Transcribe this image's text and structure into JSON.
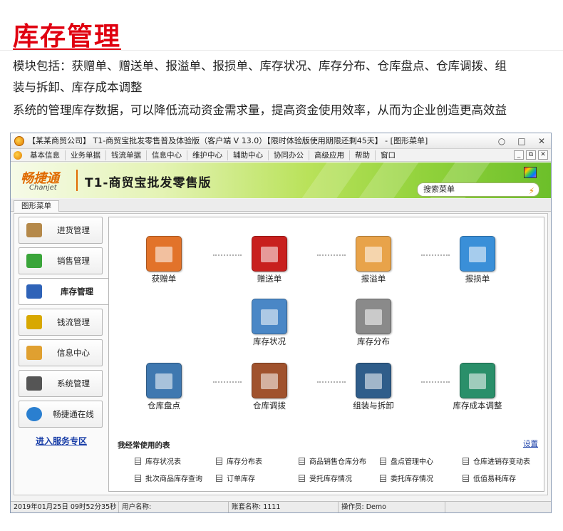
{
  "header": {
    "title": "库存管理",
    "line1": "模块包括：获赠单、赠送单、报溢单、报损单、库存状况、库存分布、仓库盘点、仓库调拨、组",
    "line2": "装与拆卸、库存成本调整",
    "line3": "系统的管理库存数据，可以降低流动资金需求量，提高资金使用效率，从而为企业创造更高效益",
    "accent_color": "#e00010"
  },
  "window": {
    "title": "【某某商贸公司】 T1-商贸宝批发零售普及体验版（客户端 V 13.0）【限时体验版使用期限还剩45天】 - [图形菜单]",
    "controls": [
      "○",
      "□",
      "✕"
    ]
  },
  "menu": {
    "items": [
      "基本信息",
      "业务单据",
      "钱流单据",
      "信息中心",
      "维护中心",
      "辅助中心",
      "协同办公",
      "高级应用",
      "帮助",
      "窗口"
    ],
    "mdi_controls": [
      "_",
      "⧉",
      "✕"
    ]
  },
  "banner": {
    "brand_cn": "畅捷通",
    "brand_en": "Chanjet",
    "product": "T1-商贸宝批发零售版",
    "search_label": "搜索菜单",
    "search_icon": "lightning-icon"
  },
  "tab": {
    "label": "图形菜单"
  },
  "sidebar": {
    "items": [
      {
        "label": "进货管理",
        "icon": "purchase-icon",
        "color": "#b5894a"
      },
      {
        "label": "销售管理",
        "icon": "shopping-basket-icon",
        "color": "#3aa53a"
      },
      {
        "label": "库存管理",
        "icon": "inventory-grid-icon",
        "color": "#2f63b8",
        "active": true
      },
      {
        "label": "钱流管理",
        "icon": "cashflow-icon",
        "color": "#d8a800"
      },
      {
        "label": "信息中心",
        "icon": "envelope-icon",
        "color": "#e0a030"
      },
      {
        "label": "系统管理",
        "icon": "settings-sliders-icon",
        "color": "#555555"
      },
      {
        "label": "畅捷通在线",
        "icon": "globe-icon",
        "color": "#2a7fd0"
      }
    ],
    "service_link": "进入服务专区"
  },
  "flow": {
    "items": [
      {
        "label": "获赠单",
        "icon": "gift-receipt-icon",
        "color": "#e2732a"
      },
      {
        "label": "赠送单",
        "icon": "gift-box-icon",
        "color": "#c8201e"
      },
      {
        "label": "报溢单",
        "icon": "overflow-chart-icon",
        "color": "#e8a34a"
      },
      {
        "label": "报损单",
        "icon": "loss-chart-icon",
        "color": "#3a8fd8"
      },
      {
        "label": "库存状况",
        "icon": "inventory-status-icon",
        "color": "#4a87c6"
      },
      {
        "label": "库存分布",
        "icon": "boxes-icon",
        "color": "#8a8a8a"
      },
      {
        "label": "仓库盘点",
        "icon": "warehouse-worker-icon",
        "color": "#3f78b0"
      },
      {
        "label": "仓库调拨",
        "icon": "transfer-arrows-icon",
        "color": "#a0522d"
      },
      {
        "label": "组装与拆卸",
        "icon": "crane-icon",
        "color": "#2f5d8a"
      },
      {
        "label": "库存成本调整",
        "icon": "cost-gauge-icon",
        "color": "#2a8f6a"
      }
    ]
  },
  "favorites": {
    "title": "我经常使用的表",
    "settings": "设置",
    "items": [
      "库存状况表",
      "库存分布表",
      "商品销售仓库分布",
      "盘点管理中心",
      "仓库进销存变动表",
      "批次商品库存查询",
      "订单库存",
      "受托库存情况",
      "委托库存情况",
      "低值易耗库存"
    ]
  },
  "status": {
    "datetime": "2019年01月25日  09时52分35秒",
    "user": "用户名称:",
    "account": "账套名称: 1111",
    "operator": "操作员: Demo"
  }
}
